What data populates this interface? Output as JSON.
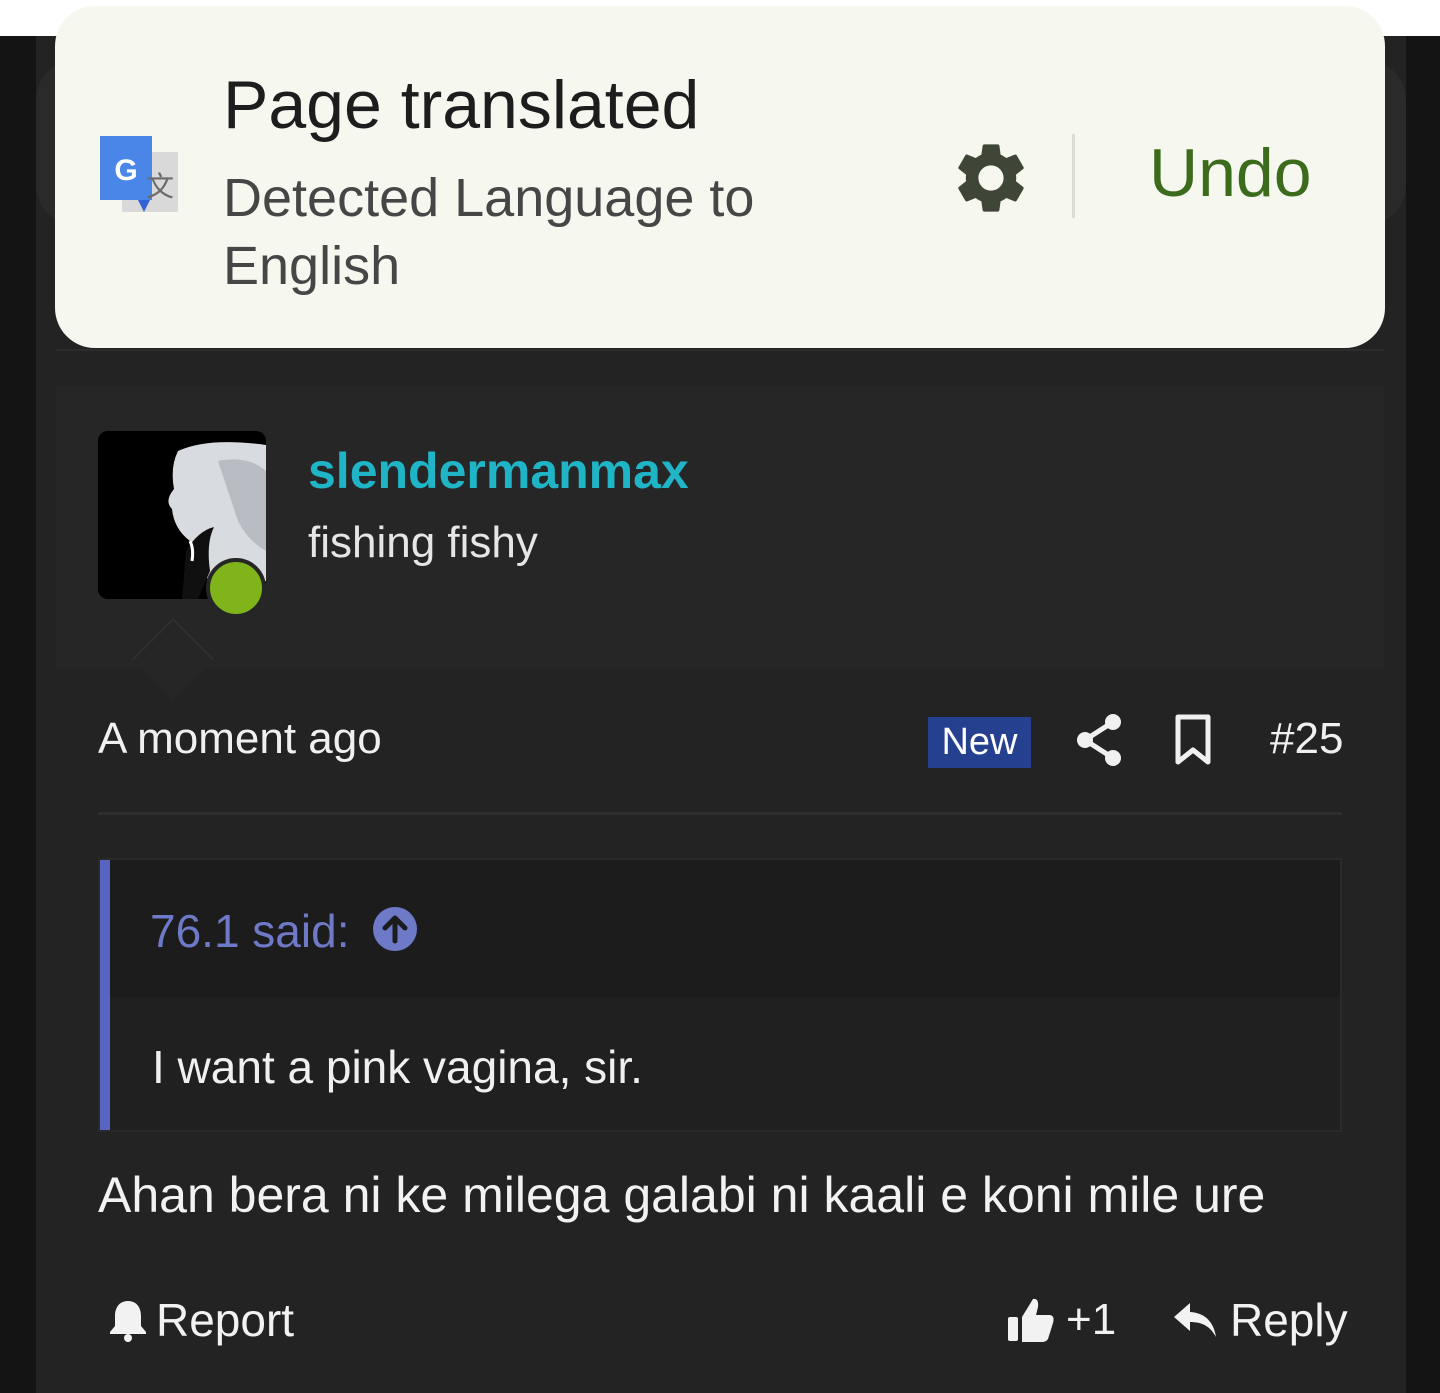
{
  "translate_bar": {
    "title": "Page translated",
    "subtitle": "Detected Language to English",
    "undo_label": "Undo",
    "accent_color": "#3d6b1e",
    "icons": [
      "google-translate-icon",
      "gear-icon"
    ]
  },
  "user": {
    "username": "slendermanmax",
    "user_title": "fishing fishy",
    "online": true,
    "username_color": "#1fb5c7"
  },
  "post_meta": {
    "timestamp": "A moment ago",
    "badge": "New",
    "post_number": "#25",
    "icons": [
      "share-icon",
      "bookmark-icon"
    ]
  },
  "quote": {
    "author_label": "76.1 said:",
    "text": "I want a pink vagina, sir.",
    "accent_color": "#5865c0"
  },
  "post": {
    "body": "Ahan bera ni ke milega galabi ni kaali e koni mile ure"
  },
  "actions": {
    "report_label": "Report",
    "like_count": "+1",
    "reply_label": "Reply",
    "icons": [
      "bell-icon",
      "thumbs-up-icon",
      "reply-arrow-icon"
    ]
  }
}
